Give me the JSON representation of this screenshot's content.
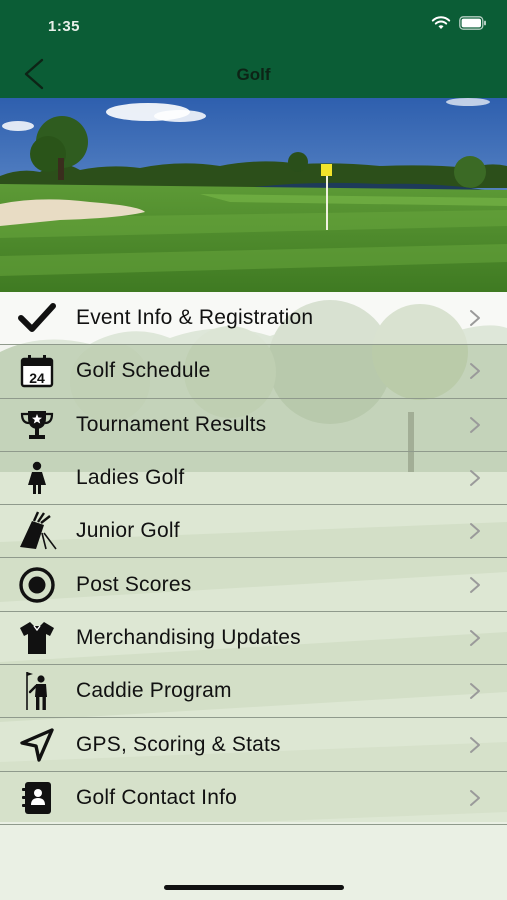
{
  "status_bar": {
    "time": "1:35"
  },
  "nav": {
    "title": "Golf",
    "back_icon": "chevron-left-icon"
  },
  "menu": {
    "items": [
      {
        "label": "Event Info & Registration",
        "icon": "checkmark-icon"
      },
      {
        "label": "Golf Schedule",
        "icon": "calendar-icon",
        "icon_text": "24"
      },
      {
        "label": "Tournament Results",
        "icon": "trophy-icon"
      },
      {
        "label": "Ladies Golf",
        "icon": "woman-icon"
      },
      {
        "label": "Junior Golf",
        "icon": "golf-bag-icon"
      },
      {
        "label": "Post Scores",
        "icon": "target-icon"
      },
      {
        "label": "Merchandising Updates",
        "icon": "shirt-icon"
      },
      {
        "label": "Caddie Program",
        "icon": "golfer-icon"
      },
      {
        "label": "GPS, Scoring & Stats",
        "icon": "location-arrow-icon"
      },
      {
        "label": "Golf Contact Info",
        "icon": "contact-book-icon"
      }
    ]
  },
  "colors": {
    "header": "#0b5d36",
    "text": "#111111"
  }
}
